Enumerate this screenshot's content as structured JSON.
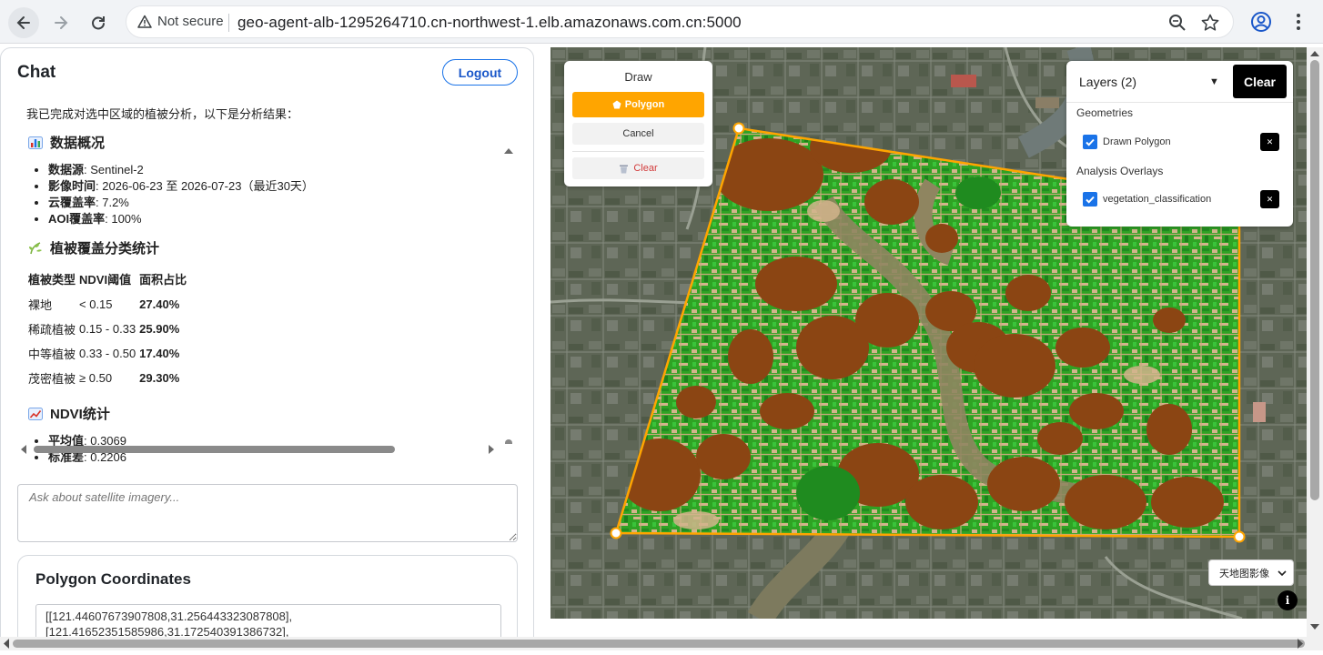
{
  "browser": {
    "security_label": "Not secure",
    "url": "geo-agent-alb-1295264710.cn-northwest-1.elb.amazonaws.com.cn:5000"
  },
  "chat": {
    "title": "Chat",
    "logout_label": "Logout",
    "intro": "我已完成对选中区域的植被分析，以下是分析结果：",
    "sections": {
      "overview": {
        "title": "数据概况",
        "items": [
          {
            "key": "数据源",
            "value": ": Sentinel-2"
          },
          {
            "key": "影像时间",
            "value": ": 2026-06-23 至 2026-07-23（最近30天）"
          },
          {
            "key": "云覆盖率",
            "value": ": 7.2%"
          },
          {
            "key": "AOI覆盖率",
            "value": ": 100%"
          }
        ]
      },
      "classification": {
        "title": "植被覆盖分类统计",
        "headers": [
          "植被类型",
          "NDVI阈值",
          "面积占比"
        ],
        "rows": [
          [
            "裸地",
            "< 0.15",
            "27.40%"
          ],
          [
            "稀疏植被",
            "0.15 - 0.33",
            "25.90%"
          ],
          [
            "中等植被",
            "0.33 - 0.50",
            "17.40%"
          ],
          [
            "茂密植被",
            "≥ 0.50",
            "29.30%"
          ]
        ]
      },
      "ndvi": {
        "title": "NDVI统计",
        "items": [
          {
            "key": "平均值",
            "value": ": 0.3069"
          },
          {
            "key": "标准差",
            "value": ": 0.2206"
          }
        ]
      }
    },
    "input_placeholder": "Ask about satellite imagery..."
  },
  "polygon_card": {
    "title": "Polygon Coordinates",
    "coords_lines": [
      "[[121.44607673907808,31.256443323087808],",
      "[121.41652351585986,31.172540391386732],"
    ]
  },
  "map": {
    "draw": {
      "title": "Draw",
      "polygon_label": "Polygon",
      "cancel_label": "Cancel",
      "clear_label": "Clear"
    },
    "layers": {
      "title": "Layers (2)",
      "clear_label": "Clear",
      "groups": [
        {
          "title": "Geometries",
          "layers": [
            {
              "name": "Drawn Polygon",
              "checked": true
            }
          ]
        },
        {
          "title": "Analysis Overlays",
          "layers": [
            {
              "name": "vegetation_classification",
              "checked": true
            }
          ]
        }
      ]
    },
    "basemap_label": "天地图影像",
    "info_label": "i",
    "colors": {
      "bare": "#8b4513",
      "sparse": "#d2b48c",
      "moderate": "#32cd32",
      "dense": "#228b22",
      "polygon": "#ffa500"
    }
  }
}
